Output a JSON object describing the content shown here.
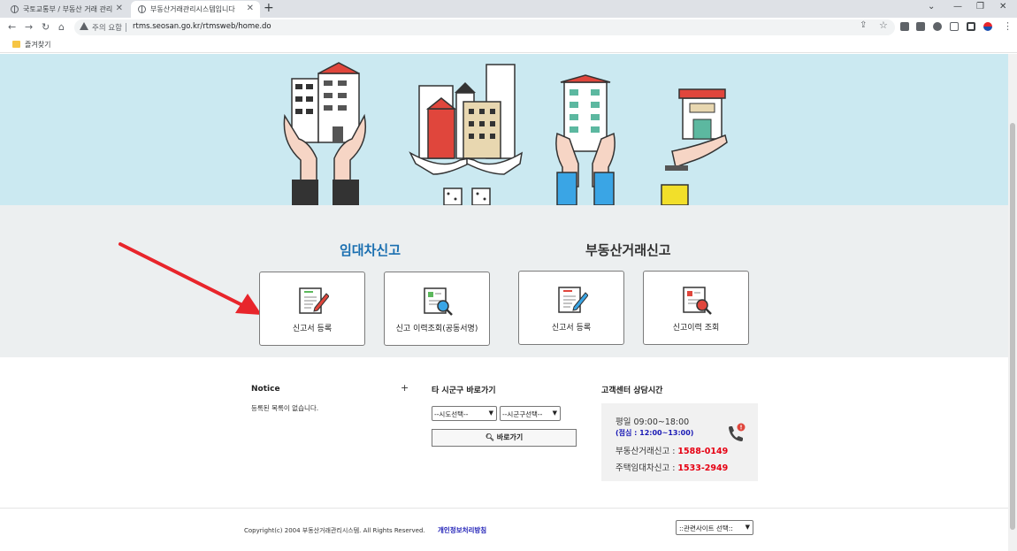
{
  "browser": {
    "tabs": [
      {
        "title": "국토교통부 / 부동산 거래 관리"
      },
      {
        "title": "부동산거래관리시스템입니다"
      }
    ],
    "security_label": "주의 요함",
    "url": "rtms.seosan.go.kr/rtmsweb/home.do",
    "bookmark": "즐겨찾기"
  },
  "page": {
    "lease_section": {
      "title": "임대차신고",
      "cards": [
        {
          "label": "신고서 등록",
          "icon": "form-pencil-icon"
        },
        {
          "label": "신고 이력조회(공동서명)",
          "icon": "form-search-icon"
        }
      ]
    },
    "trade_section": {
      "title": "부동산거래신고",
      "cards": [
        {
          "label": "신고서 등록",
          "icon": "form-pencil-icon"
        },
        {
          "label": "신고이력 조회",
          "icon": "form-search-icon"
        }
      ]
    },
    "notice": {
      "title": "Notice",
      "plus": "+",
      "empty_text": "등록된 목록이 없습니다."
    },
    "shortcut": {
      "title": "타 시군구 바로가기",
      "sido_select": "--시도선택--",
      "sigungu_select": "--시군구선택--",
      "go_button": "바로가기"
    },
    "customer_center": {
      "title": "고객센터 상담시간",
      "hours": "평일 09:00~18:00",
      "lunch": "(점심 : 12:00~13:00)",
      "lines": [
        {
          "label": "부동산거래신고 : ",
          "number": "1588-0149"
        },
        {
          "label": "주택임대차신고 : ",
          "number": "1533-2949"
        }
      ]
    },
    "footer": {
      "copyright": "Copyright(c) 2004 부동산거래관리시스템. All Rights Reserved.",
      "privacy": "개인정보처리방침",
      "related_select": "::관련사이트 선택::"
    },
    "colors": {
      "hero_bg": "#cbe9f1",
      "lease_title": "#1a6fb0",
      "trade_title": "#333333",
      "annotation_arrow": "#e8252b"
    }
  }
}
